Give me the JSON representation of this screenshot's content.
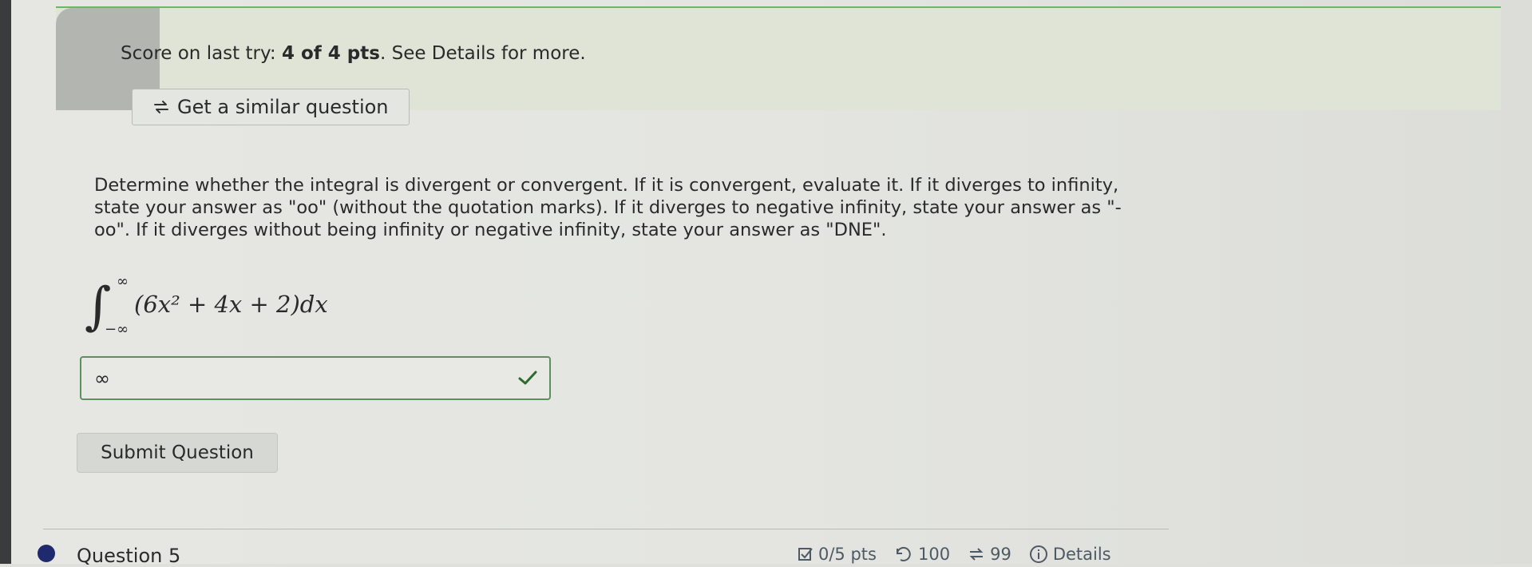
{
  "score": {
    "prefix": "Score on last try: ",
    "value": "4 of 4 pts",
    "suffix": ". See Details for more."
  },
  "similar_button": {
    "label": "Get a similar question",
    "icon": "refresh-arrows-icon"
  },
  "question": {
    "prompt": "Determine whether the integral is divergent or convergent. If it is convergent, evaluate it. If it diverges to infinity, state your answer as \"oo\" (without the quotation marks). If it diverges to negative infinity, state your answer as \"-oo\". If it diverges without being infinity or negative infinity, state your answer as \"DNE\".",
    "integral": {
      "upper": "∞",
      "lower": "−∞",
      "integrand": "(6x² + 4x + 2)dx"
    }
  },
  "answer": {
    "value": "∞",
    "status_icon": "check-icon",
    "status_color": "#2e6b2e"
  },
  "submit_button": {
    "label": "Submit Question"
  },
  "next_question": {
    "label": "Question 5",
    "points": "0/5 pts",
    "attempts": "100",
    "retries": "99",
    "details": "Details"
  }
}
